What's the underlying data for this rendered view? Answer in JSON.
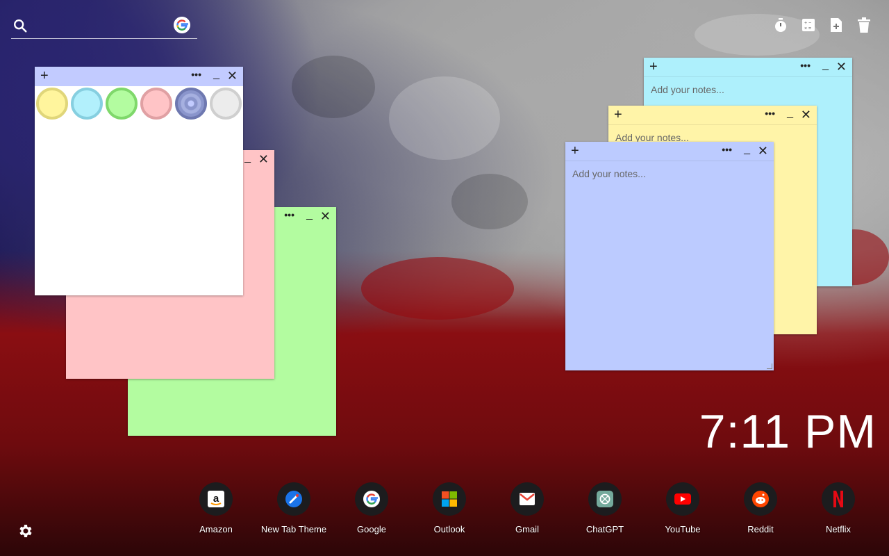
{
  "search": {
    "placeholder": "",
    "icon": "search-icon",
    "engine_icon": "google-icon"
  },
  "toolbar": {
    "icons": [
      "timer-icon",
      "calculator-icon",
      "new-note-icon",
      "trash-icon"
    ]
  },
  "notes": {
    "placeholder": "Add your notes...",
    "palette": [
      {
        "name": "yellow",
        "fill": "#fff59d",
        "ring": "#e0d67a"
      },
      {
        "name": "cyan",
        "fill": "#b2f0fc",
        "ring": "#86cfe0"
      },
      {
        "name": "green",
        "fill": "#b3fca0",
        "ring": "#7fd86b"
      },
      {
        "name": "pink",
        "fill": "#ffc4c6",
        "ring": "#e0a0a3"
      },
      {
        "name": "blue",
        "fill": "#8a95cc",
        "ring": "#6e78b0"
      },
      {
        "name": "white",
        "fill": "#ececec",
        "ring": "#cfcfcf"
      }
    ],
    "plus": "+",
    "more": "•••",
    "minimize": "_",
    "close": "✕"
  },
  "clock": {
    "time": "7:11 PM"
  },
  "dock": {
    "apps": [
      {
        "label": "Amazon",
        "icon": "amazon-icon"
      },
      {
        "label": "New Tab Theme",
        "icon": "new-tab-theme-icon"
      },
      {
        "label": "Google",
        "icon": "google-icon"
      },
      {
        "label": "Outlook",
        "icon": "outlook-icon"
      },
      {
        "label": "Gmail",
        "icon": "gmail-icon"
      },
      {
        "label": "ChatGPT",
        "icon": "chatgpt-icon"
      },
      {
        "label": "YouTube",
        "icon": "youtube-icon"
      },
      {
        "label": "Reddit",
        "icon": "reddit-icon"
      },
      {
        "label": "Netflix",
        "icon": "netflix-icon"
      }
    ]
  },
  "settings": {
    "icon": "settings-icon"
  }
}
